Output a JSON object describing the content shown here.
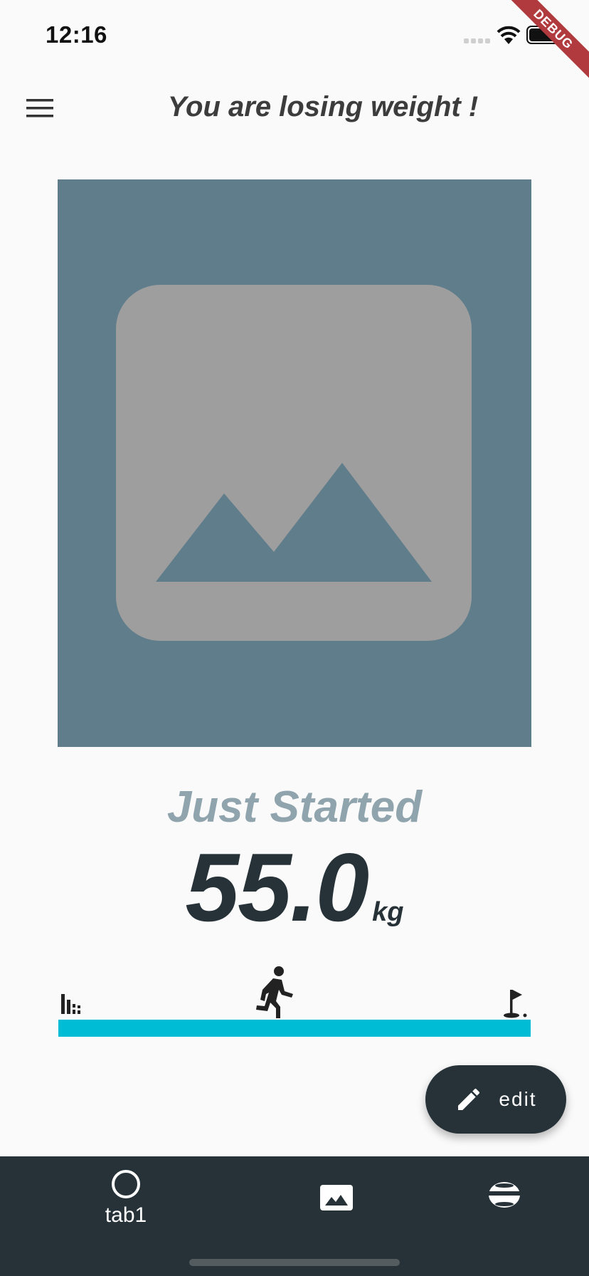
{
  "status_bar": {
    "time": "12:16",
    "debug_banner": "DEBUG"
  },
  "app_bar": {
    "title": "You are losing weight !",
    "menu_icon": "hamburger-menu-icon"
  },
  "hero": {
    "icon": "image-placeholder-icon",
    "background": "#607d8b",
    "icon_color": "#9e9e9e"
  },
  "stats": {
    "status": "Just Started",
    "weight": "55.0",
    "unit": "kg"
  },
  "progress": {
    "start_icon": "bar-chart-icon",
    "current_icon": "runner-icon",
    "goal_icon": "golf-flag-icon",
    "bar_color": "#00bcd4"
  },
  "fab": {
    "label": "edit",
    "icon": "pencil-icon"
  },
  "bottom_nav": {
    "tabs": [
      {
        "label": "tab1",
        "icon": "circle-outline-icon"
      },
      {
        "label": "",
        "icon": "image-icon"
      },
      {
        "label": "",
        "icon": "stadium-icon"
      }
    ]
  },
  "colors": {
    "dark": "#263238",
    "accent": "#00bcd4",
    "muted": "#90a4ae"
  }
}
